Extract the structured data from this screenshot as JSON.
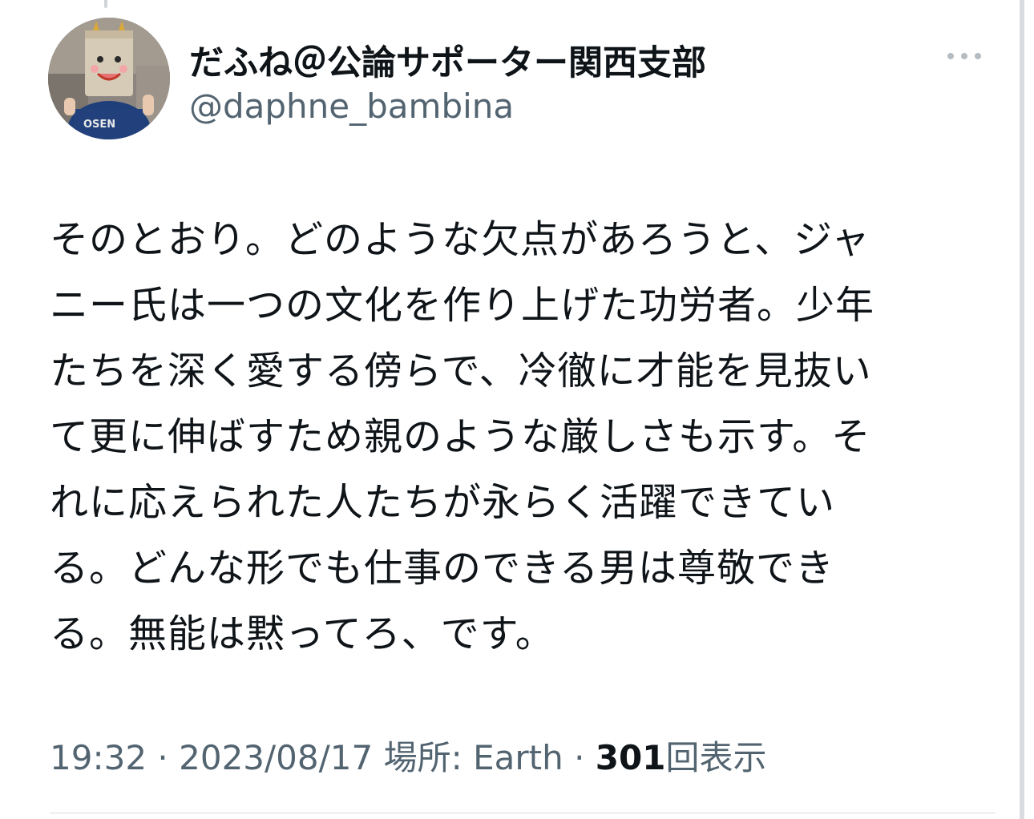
{
  "tweet": {
    "author": {
      "display_name": "だふね＠公論サポーター関西支部",
      "handle": "@daphne_bambina",
      "avatar_shirt_text": "OSEN"
    },
    "text_lines": [
      "そのとおり。どのような欠点があろうと、ジャ",
      "ニー氏は一つの文化を作り上げた功労者。少年",
      "たちを深く愛する傍らで、冷徹に才能を見抜い",
      "て更に伸ばすため親のような厳しさも示す。そ",
      "れに応えられた人たちが永らく活躍できてい",
      "る。どんな形でも仕事のできる男は尊敬でき",
      "る。無能は黙ってろ、です。"
    ],
    "meta": {
      "time": "19:32",
      "separator": "·",
      "date": "2023/08/17",
      "location_label": "場所: Earth",
      "views_count": "301",
      "views_label": "回表示"
    },
    "more_icon": "more-horizontal-icon"
  },
  "colors": {
    "text_primary": "#0f1419",
    "text_secondary": "#536471",
    "divider": "#d7dbdf"
  }
}
